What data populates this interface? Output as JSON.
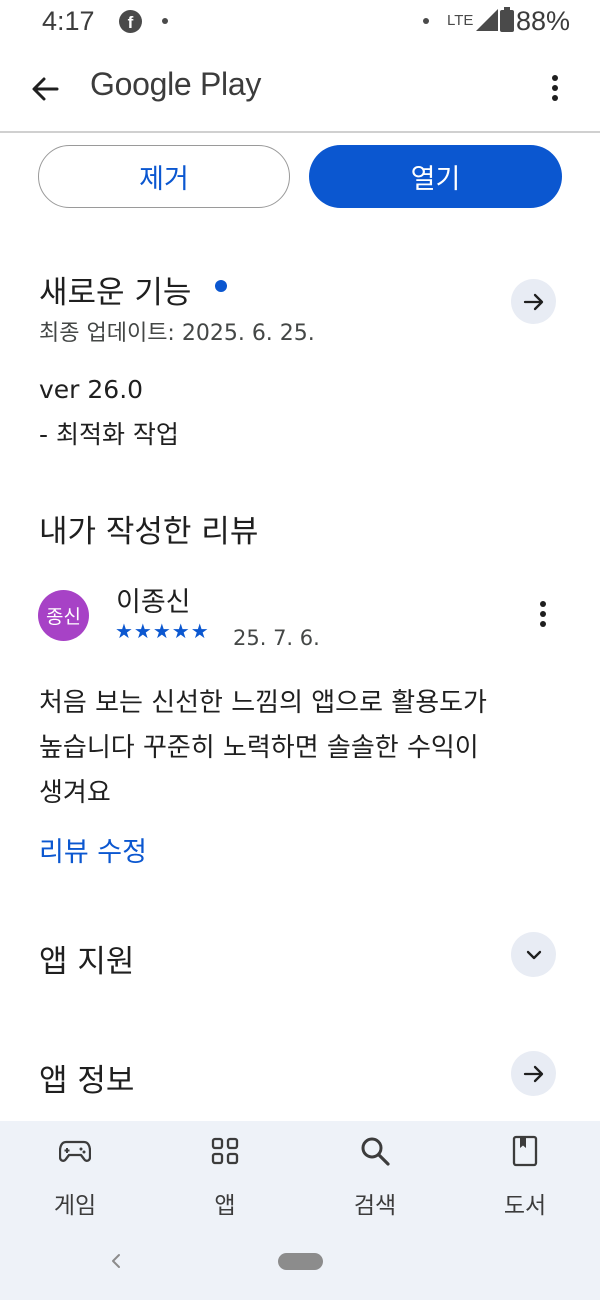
{
  "status_bar": {
    "time": "4:17",
    "fb_glyph": "f",
    "network": "LTE",
    "battery": "88%"
  },
  "app_bar": {
    "title": "Google Play"
  },
  "actions": {
    "remove_label": "제거",
    "open_label": "열기"
  },
  "whats_new": {
    "title": "새로운 기능",
    "updated": "최종 업데이트: 2025. 6. 25.",
    "version": "ver 26.0",
    "note": "- 최적화 작업"
  },
  "my_review": {
    "section_title": "내가 작성한 리뷰",
    "avatar_text": "종신",
    "author": "이종신",
    "stars": "★★★★★",
    "rating": 5,
    "date": "25. 7. 6.",
    "text_lines": [
      "처음 보는 신선한 느낌의 앱으로 활용도가",
      "높습니다 꾸준히 노력하면 솔솔한 수익이",
      "생겨요"
    ],
    "edit_label": "리뷰 수정"
  },
  "app_support": {
    "title": "앱 지원"
  },
  "app_info": {
    "title": "앱 정보"
  },
  "bottom_nav": {
    "items": [
      {
        "label": "게임",
        "icon": "gamepad-icon"
      },
      {
        "label": "앱",
        "icon": "apps-grid-icon"
      },
      {
        "label": "검색",
        "icon": "search-icon"
      },
      {
        "label": "도서",
        "icon": "book-icon"
      }
    ]
  },
  "colors": {
    "accent": "#0b57d0",
    "avatar": "#a742c6",
    "nav_bg": "#eef2f8",
    "round_button_bg": "#e8ecf4"
  }
}
